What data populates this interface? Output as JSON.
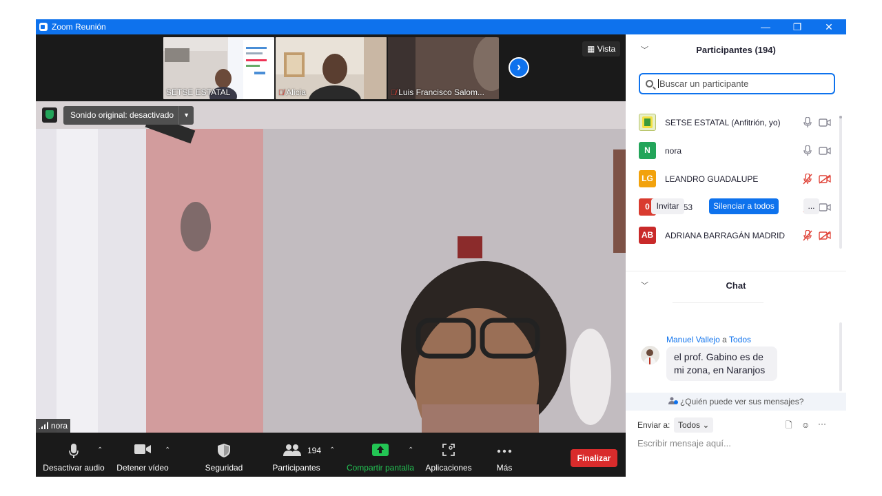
{
  "window": {
    "title": "Zoom Reunión",
    "controls": [
      "—",
      "❐",
      "✕"
    ]
  },
  "thumbnails": [
    {
      "name": "SETSE ESTATAL",
      "muted": false
    },
    {
      "name": "Alicia",
      "muted": true
    },
    {
      "name": "Luis Francisco Salom...",
      "muted": true
    }
  ],
  "view_button": "Vista",
  "main_video": {
    "sound_label": "Sonido original: desactivado",
    "speaker_name": "nora"
  },
  "toolbar": {
    "audio": "Desactivar audio",
    "video": "Detener vídeo",
    "security": "Seguridad",
    "participants": "Participantes",
    "participants_count": "194",
    "share": "Compartir pantalla",
    "apps": "Aplicaciones",
    "more": "Más",
    "end": "Finalizar"
  },
  "participants_panel": {
    "title": "Participantes (194)",
    "search_placeholder": "Buscar un participante",
    "list": [
      {
        "initials": "",
        "name": "SETSE ESTATAL (Anfitrión, yo)",
        "color": "#e8f0c8",
        "mic_muted": false,
        "cam_off": false
      },
      {
        "initials": "N",
        "name": "nora",
        "color": "#23a55a",
        "mic_muted": false,
        "cam_off": false
      },
      {
        "initials": "LG",
        "name": " LEANDRO GUADALUPE",
        "color": "#f2a20c",
        "mic_muted": true,
        "cam_off": true
      },
      {
        "initials": "0",
        "name": "044753",
        "color": "#d93b2f",
        "mic_muted": true,
        "cam_off": false
      },
      {
        "initials": "AB",
        "name": "ADRIANA BARRAGÁN MADRID",
        "color": "#c92a2a",
        "mic_muted": true,
        "cam_off": true
      }
    ],
    "invite": "Invitar",
    "mute_all": "Silenciar a todos",
    "more": "..."
  },
  "chat": {
    "title": "Chat",
    "sender": "Manuel Vallejo",
    "to_word": "a",
    "recipient": "Todos",
    "message": "el prof. Gabino es de mi zona, en Naranjos",
    "who_can_see": "¿Quién puede ver sus mensajes?",
    "send_to_label": "Enviar a:",
    "send_to_value": "Todos",
    "input_placeholder": "Escribir mensaje aquí..."
  },
  "colors": {
    "accent": "#0e72ed",
    "end": "#d92c2c",
    "share": "#23c554",
    "muted": "#e0453a"
  }
}
